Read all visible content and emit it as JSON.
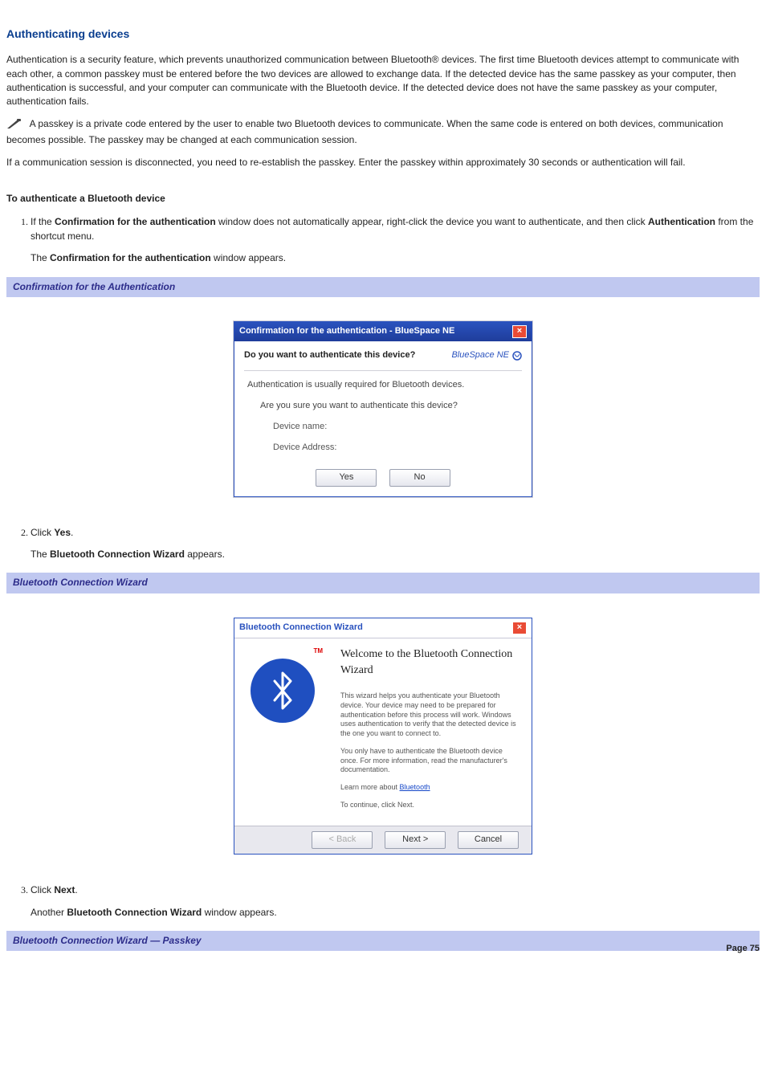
{
  "heading": "Authenticating devices",
  "intro_para": "Authentication is a security feature, which prevents unauthorized communication between Bluetooth® devices. The first time Bluetooth devices attempt to communicate with each other, a common passkey must be entered before the two devices are allowed to exchange data. If the detected device has the same passkey as your computer, then authentication is successful, and your computer can communicate with the Bluetooth device. If the detected device does not have the same passkey as your computer, authentication fails.",
  "note_para": "A passkey is a private code entered by the user to enable two Bluetooth devices to communicate. When the same code is entered on both devices, communication becomes possible. The passkey may be changed at each communication session.",
  "note_para2": "If a communication session is disconnected, you need to re-establish the passkey. Enter the passkey within approximately 30 seconds or authentication will fail.",
  "subhead": "To authenticate a Bluetooth device",
  "steps": {
    "s1_pre": "If the ",
    "s1_b1": "Confirmation for the authentication",
    "s1_mid": " window does not automatically appear, right-click the device you want to authenticate, and then click ",
    "s1_b2": "Authentication",
    "s1_post": " from the shortcut menu.",
    "s1_result_pre": "The ",
    "s1_result_b": "Confirmation for the authentication",
    "s1_result_post": " window appears.",
    "s2_pre": "Click ",
    "s2_b": "Yes",
    "s2_post": ".",
    "s2_result_pre": "The ",
    "s2_result_b": "Bluetooth Connection Wizard",
    "s2_result_post": " appears.",
    "s3_pre": "Click ",
    "s3_b": "Next",
    "s3_post": ".",
    "s3_result_pre": "Another ",
    "s3_result_b": "Bluetooth Connection Wizard",
    "s3_result_post": " window appears."
  },
  "caption1": "Confirmation for the Authentication",
  "caption2": "Bluetooth Connection Wizard",
  "caption3": "Bluetooth Connection Wizard — Passkey",
  "dialog1": {
    "title": "Confirmation for the authentication - BlueSpace NE",
    "prompt": "Do you want to authenticate this device?",
    "brand": "BlueSpace NE",
    "line1": "Authentication is usually required for Bluetooth devices.",
    "line2": "Are you sure you want to authenticate this device?",
    "dev_name": "Device name:",
    "dev_addr": "Device Address:",
    "yes": "Yes",
    "no": "No"
  },
  "wizard": {
    "title": "Bluetooth Connection Wizard",
    "heading": "Welcome to the Bluetooth Connection Wizard",
    "p1": "This wizard helps you authenticate your Bluetooth device. Your device may need to be prepared for authentication before this process will work. Windows uses authentication to verify that the detected device is the one you want to connect to.",
    "p2": "You only have to authenticate the Bluetooth device once. For more information, read the manufacturer's documentation.",
    "learn_pre": "Learn more about ",
    "learn_link": "Bluetooth",
    "cont": "To continue, click Next.",
    "back": "< Back",
    "next": "Next >",
    "cancel": "Cancel",
    "tm": "TM"
  },
  "page_label": "Page 75"
}
